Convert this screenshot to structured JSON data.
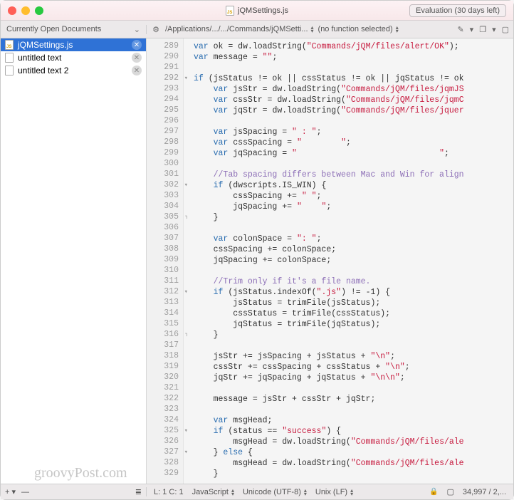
{
  "window": {
    "title": "jQMSettings.js",
    "eval_badge": "Evaluation (30 days left)"
  },
  "toolbar": {
    "sidebar_header": "Currently Open Documents",
    "path": "/Applications/.../.../Commands/jQMSetti...",
    "func_selector": "(no function selected)"
  },
  "sidebar": {
    "items": [
      {
        "label": "jQMSettings.js",
        "selected": true,
        "icon": "js"
      },
      {
        "label": "untitled text",
        "selected": false,
        "icon": "plain"
      },
      {
        "label": "untitled text 2",
        "selected": false,
        "icon": "plain"
      }
    ]
  },
  "editor": {
    "first_line": 289,
    "fold_down": [
      292,
      302,
      312,
      325,
      327
    ],
    "fold_up": [
      305,
      316
    ],
    "lines": [
      {
        "n": 289,
        "html": "<span class='kw'>var</span> ok = dw.loadString(<span class='str'>\"Commands/jQM/files/alert/OK\"</span>);"
      },
      {
        "n": 290,
        "html": "<span class='kw'>var</span> message = <span class='str'>\"\"</span>;"
      },
      {
        "n": 291,
        "html": ""
      },
      {
        "n": 292,
        "html": "<span class='kw'>if</span> (jsStatus != ok || cssStatus != ok || jqStatus != ok"
      },
      {
        "n": 293,
        "html": "    <span class='kw'>var</span> jsStr = dw.loadString(<span class='str'>\"Commands/jQM/files/jqmJS</span>"
      },
      {
        "n": 294,
        "html": "    <span class='kw'>var</span> cssStr = dw.loadString(<span class='str'>\"Commands/jQM/files/jqmC</span>"
      },
      {
        "n": 295,
        "html": "    <span class='kw'>var</span> jqStr = dw.loadString(<span class='str'>\"Commands/jQM/files/jquer</span>"
      },
      {
        "n": 296,
        "html": ""
      },
      {
        "n": 297,
        "html": "    <span class='kw'>var</span> jsSpacing = <span class='str'>\" : \"</span>;"
      },
      {
        "n": 298,
        "html": "    <span class='kw'>var</span> cssSpacing = <span class='str'>\"        \"</span>;"
      },
      {
        "n": 299,
        "html": "    <span class='kw'>var</span> jqSpacing = <span class='str'>\"                             \"</span>;"
      },
      {
        "n": 300,
        "html": ""
      },
      {
        "n": 301,
        "html": "    <span class='cm'>//Tab spacing differs between Mac and Win for align</span>"
      },
      {
        "n": 302,
        "html": "    <span class='kw'>if</span> (dwscripts.IS_WIN) {"
      },
      {
        "n": 303,
        "html": "        cssSpacing += <span class='str'>\" \"</span>;"
      },
      {
        "n": 304,
        "html": "        jqSpacing += <span class='str'>\"    \"</span>;"
      },
      {
        "n": 305,
        "html": "    }"
      },
      {
        "n": 306,
        "html": ""
      },
      {
        "n": 307,
        "html": "    <span class='kw'>var</span> colonSpace = <span class='str'>\": \"</span>;"
      },
      {
        "n": 308,
        "html": "    cssSpacing += colonSpace;"
      },
      {
        "n": 309,
        "html": "    jqSpacing += colonSpace;"
      },
      {
        "n": 310,
        "html": ""
      },
      {
        "n": 311,
        "html": "    <span class='cm'>//Trim only if it's a file name.</span>"
      },
      {
        "n": 312,
        "html": "    <span class='kw'>if</span> (jsStatus.indexOf(<span class='str'>\".js\"</span>) != -<span class='num'>1</span>) {"
      },
      {
        "n": 313,
        "html": "        jsStatus = trimFile(jsStatus);"
      },
      {
        "n": 314,
        "html": "        cssStatus = trimFile(cssStatus);"
      },
      {
        "n": 315,
        "html": "        jqStatus = trimFile(jqStatus);"
      },
      {
        "n": 316,
        "html": "    }"
      },
      {
        "n": 317,
        "html": ""
      },
      {
        "n": 318,
        "html": "    jsStr += jsSpacing + jsStatus + <span class='str'>\"\\n\"</span>;"
      },
      {
        "n": 319,
        "html": "    cssStr += cssSpacing + cssStatus + <span class='str'>\"\\n\"</span>;"
      },
      {
        "n": 320,
        "html": "    jqStr += jqSpacing + jqStatus + <span class='str'>\"\\n\\n\"</span>;"
      },
      {
        "n": 321,
        "html": ""
      },
      {
        "n": 322,
        "html": "    message = jsStr + cssStr + jqStr;"
      },
      {
        "n": 323,
        "html": ""
      },
      {
        "n": 324,
        "html": "    <span class='kw'>var</span> msgHead;"
      },
      {
        "n": 325,
        "html": "    <span class='kw'>if</span> (status == <span class='str'>\"success\"</span>) {"
      },
      {
        "n": 326,
        "html": "        msgHead = dw.loadString(<span class='str'>\"Commands/jQM/files/ale</span>"
      },
      {
        "n": 327,
        "html": "    } <span class='kw'>else</span> {"
      },
      {
        "n": 328,
        "html": "        msgHead = dw.loadString(<span class='str'>\"Commands/jQM/files/ale</span>"
      },
      {
        "n": 329,
        "html": "    }"
      }
    ]
  },
  "status": {
    "cursor": "L: 1 C: 1",
    "language": "JavaScript",
    "encoding": "Unicode (UTF-8)",
    "line_endings": "Unix (LF)",
    "saved_icon": "saved",
    "counts": "34,997 / 2,..."
  },
  "watermark": "groovyPost.com"
}
